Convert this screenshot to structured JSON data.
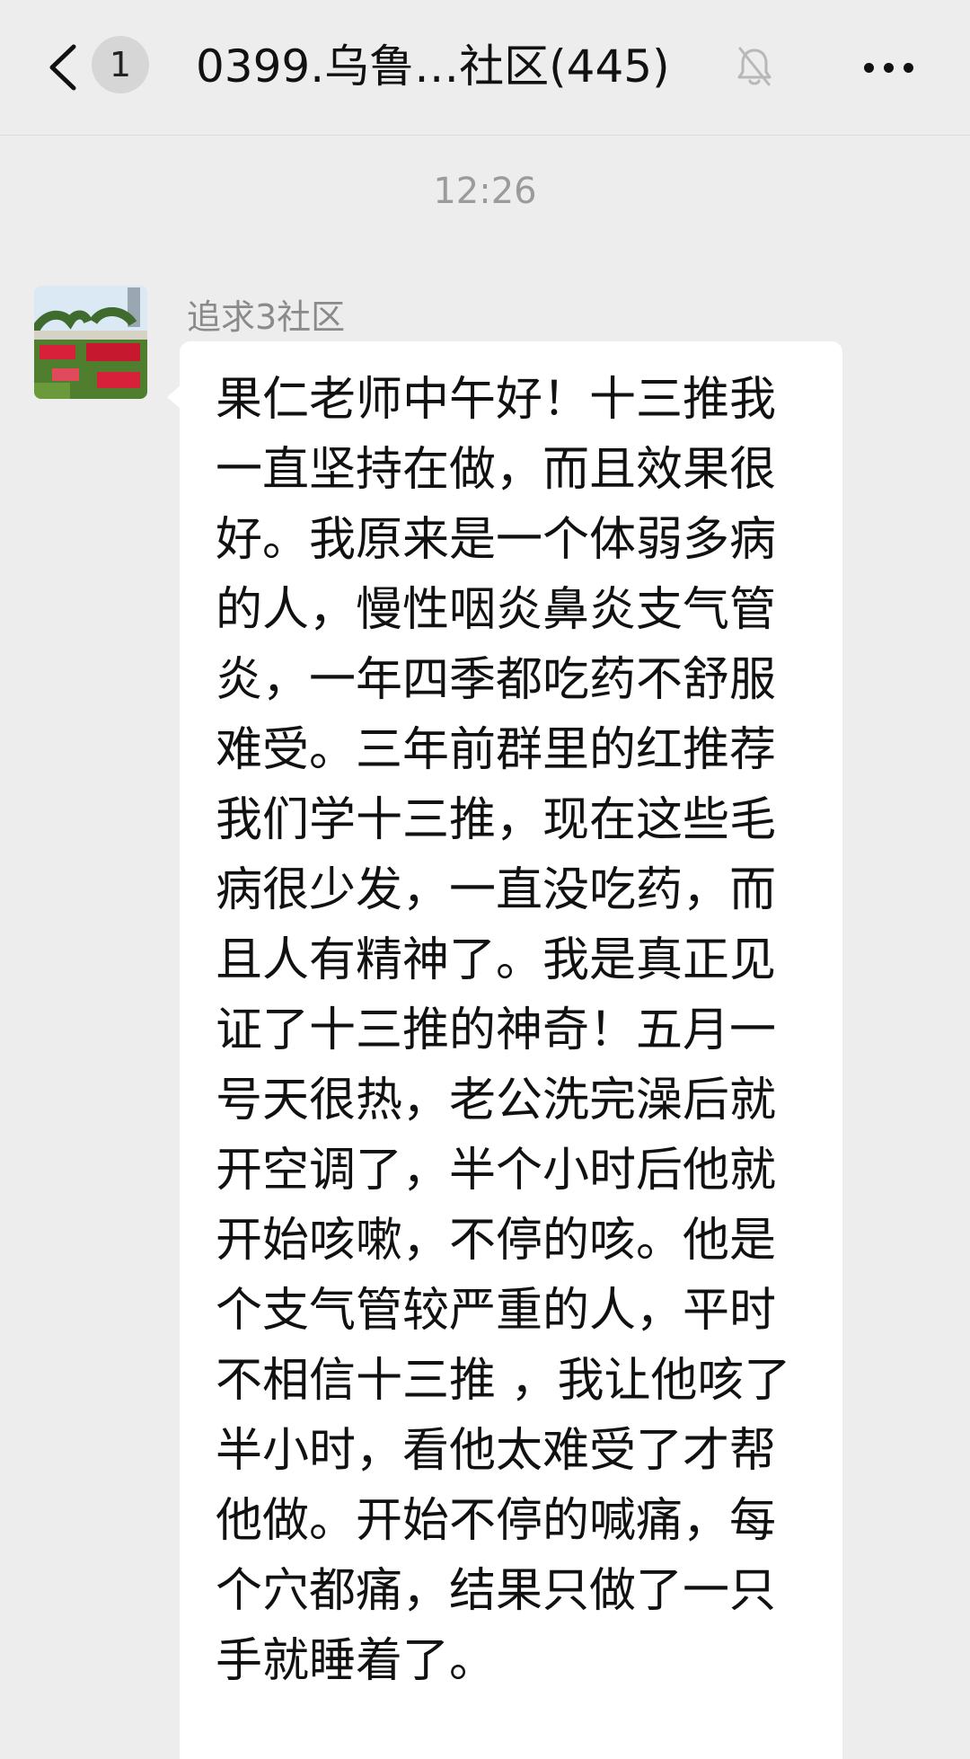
{
  "header": {
    "unread_count": "1",
    "title": "0399.乌鲁…社区(445)",
    "icons": {
      "back": "chevron-left-icon",
      "mute": "bell-off-icon",
      "more": "more-horizontal-icon"
    }
  },
  "chat": {
    "timestamp": "12:26",
    "message": {
      "sender": "追求3社区",
      "text": "果仁老师中午好！十三推我一直坚持在做，而且效果很好。我原来是一个体弱多病的人，慢性咽炎鼻炎支气管炎，一年四季都吃药不舒服难受。三年前群里的红推荐我们学十三推，现在这些毛病很少发，一直没吃药，而且人有精神了。我是真正见证了十三推的神奇！五月一号天很热，老公洗完澡后就开空调了，半个小时后他就开始咳嗽，不停的咳。他是个支气管较严重的人，平时不相信十三推 ，我让他咳了半小时，看他太难受了才帮他做。开始不停的喊痛，每个穴都痛，结果只做了一只手就睡着了。"
    }
  },
  "colors": {
    "background": "#ededed",
    "bubble": "#ffffff",
    "text": "#111111",
    "meta_text": "#9b9b9b"
  }
}
